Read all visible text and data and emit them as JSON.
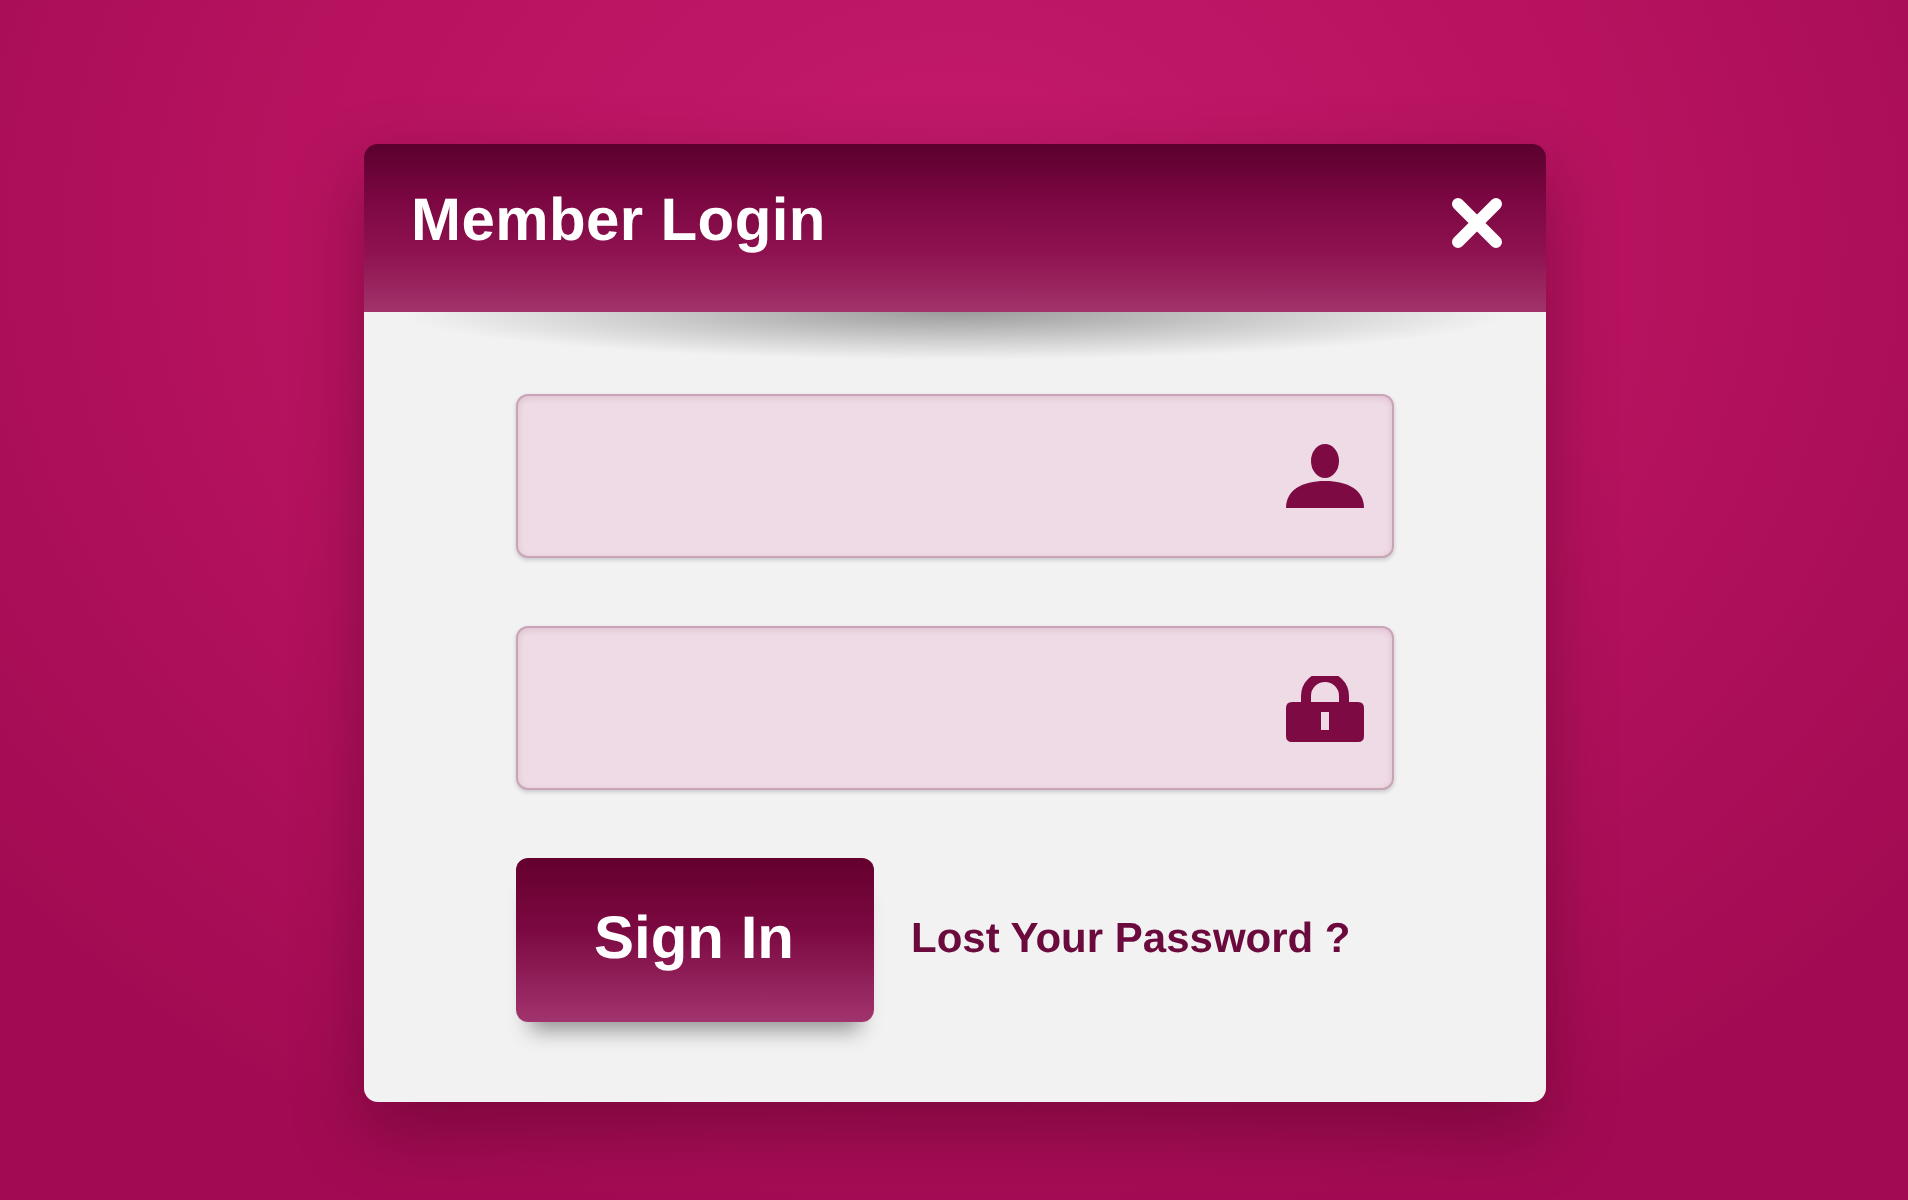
{
  "dialog": {
    "title": "Member Login"
  },
  "fields": [
    {
      "kind": "username"
    },
    {
      "kind": "password"
    }
  ],
  "actions": {
    "button": "Sign In",
    "link": "Lost Your Password ?"
  }
}
